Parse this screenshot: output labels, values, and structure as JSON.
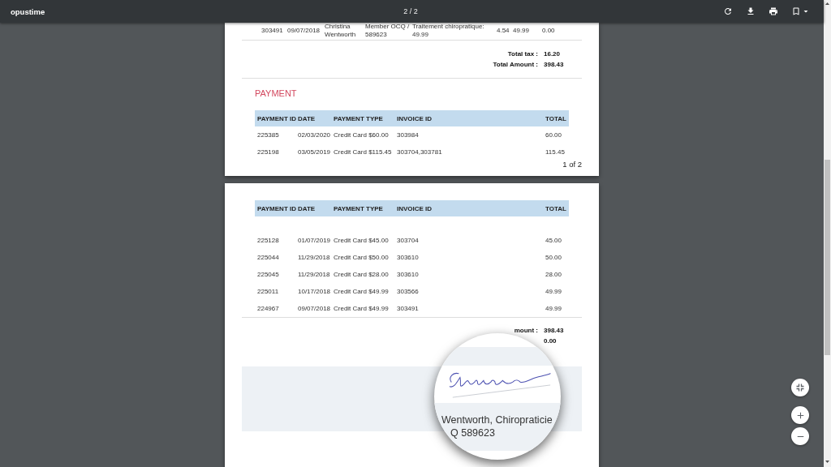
{
  "toolbar": {
    "title": "opustime",
    "page_indicator": "2 / 2"
  },
  "pages": [
    {
      "invoice_row": [
        "303491",
        "09/07/2018",
        "Christina Wentworth",
        "Member OCQ / 589623",
        "Traitement chiropratique: 49.99",
        "4.54",
        "49.99",
        "0.00"
      ],
      "totals": [
        {
          "label": "Total tax :",
          "value": "16.20"
        },
        {
          "label": "Total Amount :",
          "value": "398.43"
        }
      ],
      "payment": {
        "title": "PAYMENT",
        "columns": [
          "PAYMENT ID",
          "DATE",
          "PAYMENT TYPE",
          "INVOICE ID",
          "TOTAL"
        ],
        "rows": [
          [
            "225385",
            "02/03/2020",
            "Credit Card $60.00",
            "303984",
            "60.00"
          ],
          [
            "225198",
            "03/05/2019",
            "Credit Card $115.45",
            "303704,303781",
            "115.45"
          ]
        ]
      },
      "page_number": "1 of 2"
    },
    {
      "payment": {
        "columns": [
          "PAYMENT ID",
          "DATE",
          "PAYMENT TYPE",
          "INVOICE ID",
          "TOTAL"
        ],
        "rows": [
          [
            "225128",
            "01/07/2019",
            "Credit Card $45.00",
            "303704",
            "45.00"
          ],
          [
            "225044",
            "11/29/2018",
            "Credit Card $50.00",
            "303610",
            "50.00"
          ],
          [
            "225045",
            "11/29/2018",
            "Credit Card $28.00",
            "303610",
            "28.00"
          ],
          [
            "225011",
            "10/17/2018",
            "Credit Card $49.99",
            "303566",
            "49.99"
          ],
          [
            "224967",
            "09/07/2018",
            "Credit Card $49.99",
            "303491",
            "49.99"
          ]
        ]
      },
      "totals": [
        {
          "label": "mount :",
          "value": "398.43"
        },
        {
          "value": "0.00"
        }
      ],
      "signature_panel": {
        "magnifier": {
          "caption_lines": [
            "Wentworth, Chiropraticie",
            "Q 589623"
          ]
        }
      }
    }
  ]
}
